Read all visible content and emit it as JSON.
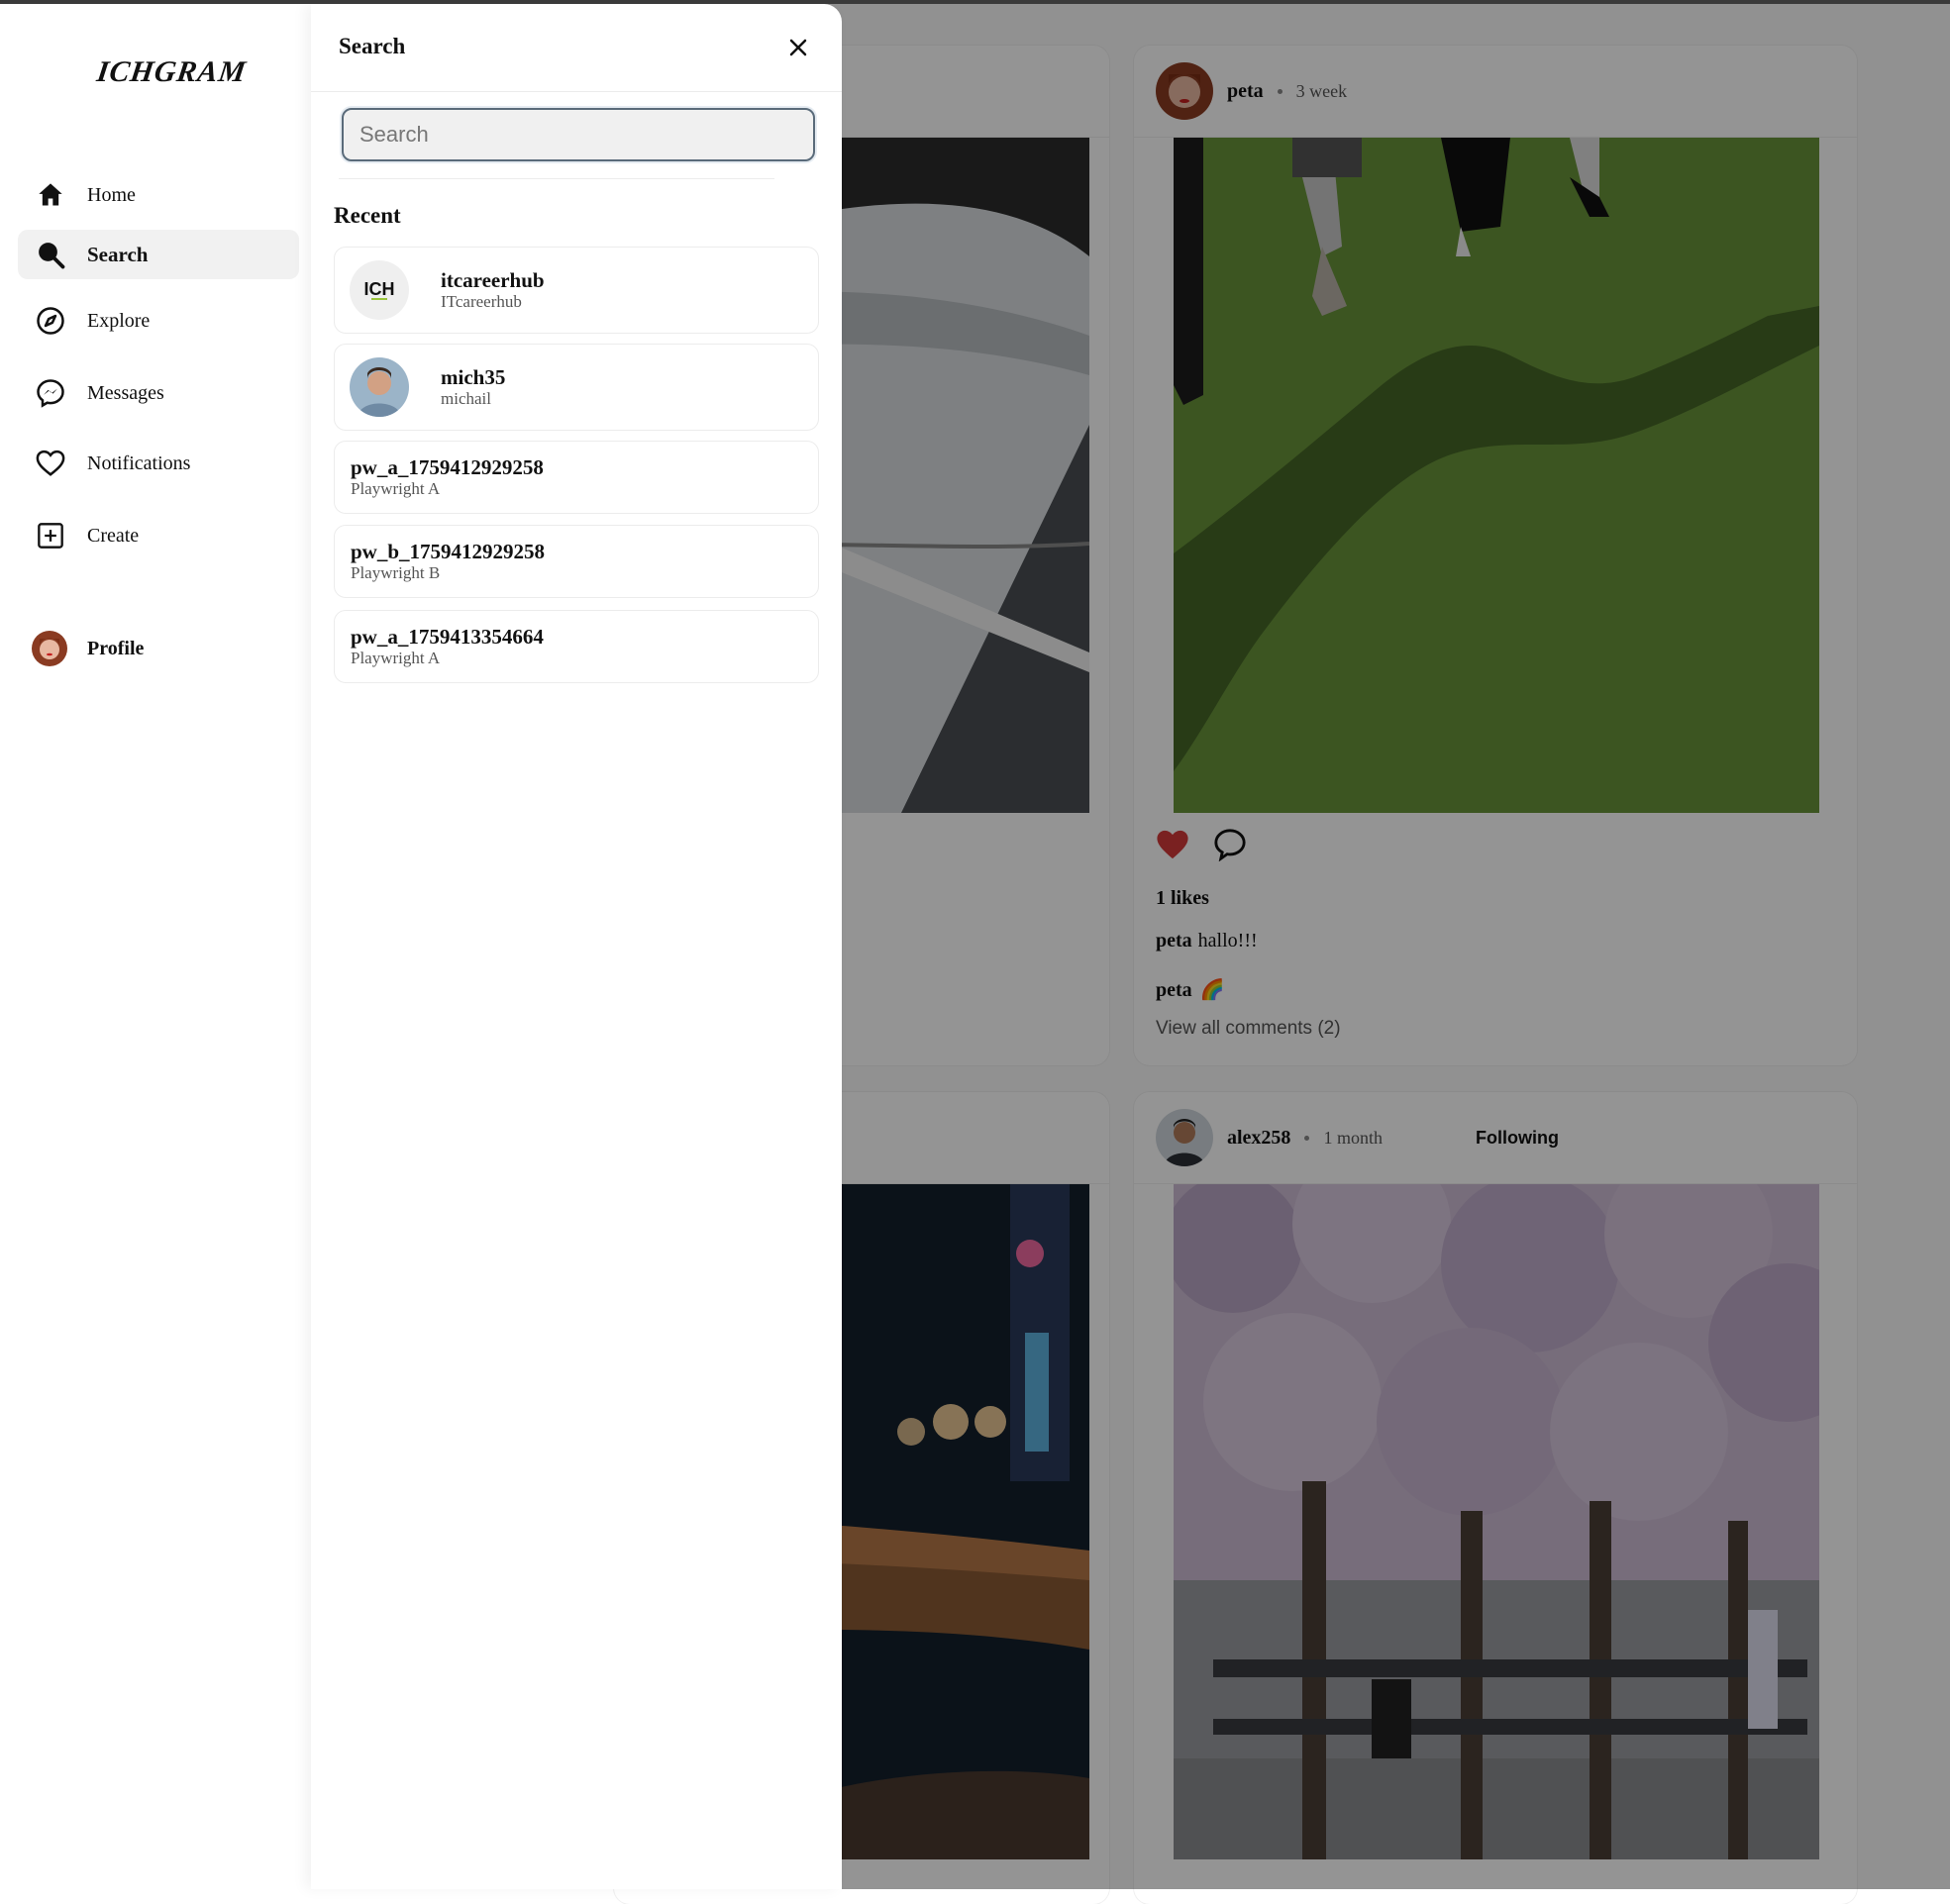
{
  "app": {
    "logo": "ICHGRAM"
  },
  "sidebar": {
    "items": [
      {
        "label": "Home",
        "icon": "home-icon"
      },
      {
        "label": "Search",
        "icon": "search-icon",
        "active": true
      },
      {
        "label": "Explore",
        "icon": "compass-icon"
      },
      {
        "label": "Messages",
        "icon": "messenger-icon"
      },
      {
        "label": "Notifications",
        "icon": "heart-icon"
      },
      {
        "label": "Create",
        "icon": "plus-square-icon"
      }
    ],
    "profile_label": "Profile"
  },
  "search_panel": {
    "title": "Search",
    "input_placeholder": "Search",
    "input_value": "",
    "recent_heading": "Recent",
    "results": [
      {
        "username": "itcareerhub",
        "fullname": "ITcareerhub",
        "avatar": "ich-logo"
      },
      {
        "username": "mich35",
        "fullname": "michail",
        "avatar": "photo-man"
      },
      {
        "username": "pw_a_1759412929258",
        "fullname": "Playwright A",
        "avatar": ""
      },
      {
        "username": "pw_b_1759412929258",
        "fullname": "Playwright B",
        "avatar": ""
      },
      {
        "username": "pw_a_1759413354664",
        "fullname": "Playwright A",
        "avatar": ""
      }
    ]
  },
  "feed": {
    "posts": [
      {
        "username": "peta",
        "time": "3 week",
        "likes_text": "1 likes",
        "caption_user": "peta",
        "caption_text": "hallo!!!",
        "comment_user": "peta",
        "comment_text": "🌈",
        "view_comments": "View all comments (2)",
        "liked": true
      },
      {
        "username": "alex258",
        "time": "1 month",
        "follow_label": "Following"
      }
    ]
  },
  "colors": {
    "like_red": "#d33a3a",
    "overlay": "rgba(0,0,0,0.42)",
    "active_nav_bg": "#f1f1f1"
  }
}
